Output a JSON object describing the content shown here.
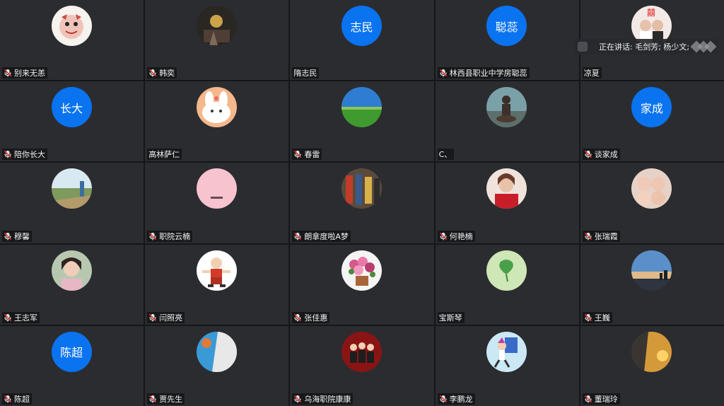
{
  "speaking_banner": {
    "text": "正在讲话: 毛剑芳; 杨少文;"
  },
  "participants": [
    {
      "name": "别来无恙",
      "avatar": "photo-cartoon-creature",
      "initials": "",
      "muted": true
    },
    {
      "name": "韩奕",
      "avatar": "photo-dark-scene",
      "initials": "",
      "muted": true
    },
    {
      "name": "隋志民",
      "avatar": "initials",
      "initials": "志民",
      "muted": false
    },
    {
      "name": "林西县职业中学房聪蕊",
      "avatar": "initials",
      "initials": "聪蕊",
      "muted": true
    },
    {
      "name": "凉夏",
      "avatar": "photo-couple",
      "initials": "",
      "muted": false
    },
    {
      "name": "陪你长大",
      "avatar": "initials",
      "initials": "长大",
      "muted": true
    },
    {
      "name": "高林萨仁",
      "avatar": "photo-cartoon-bunny",
      "initials": "",
      "muted": false
    },
    {
      "name": "春雷",
      "avatar": "photo-green-field",
      "initials": "",
      "muted": true
    },
    {
      "name": "C、",
      "avatar": "photo-rider",
      "initials": "",
      "muted": false
    },
    {
      "name": "谈家成",
      "avatar": "initials",
      "initials": "家成",
      "muted": true
    },
    {
      "name": "穆馨",
      "avatar": "photo-landscape",
      "initials": "",
      "muted": true
    },
    {
      "name": "职院云楠",
      "avatar": "photo-pink-card",
      "initials": "",
      "muted": true
    },
    {
      "name": "朗拿度啦A梦",
      "avatar": "photo-crowd",
      "initials": "",
      "muted": true
    },
    {
      "name": "何艳楠",
      "avatar": "photo-woman-red",
      "initials": "",
      "muted": true
    },
    {
      "name": "张瑞霞",
      "avatar": "photo-babies",
      "initials": "",
      "muted": true
    },
    {
      "name": "王志军",
      "avatar": "photo-girl-portrait",
      "initials": "",
      "muted": true
    },
    {
      "name": "闫照亮",
      "avatar": "photo-cartoon-kungfu",
      "initials": "",
      "muted": true
    },
    {
      "name": "张佳惠",
      "avatar": "photo-flowers",
      "initials": "",
      "muted": true
    },
    {
      "name": "宝斯琴",
      "avatar": "photo-ginkgo-leaf",
      "initials": "",
      "muted": false
    },
    {
      "name": "王巍",
      "avatar": "photo-sky-city",
      "initials": "",
      "muted": true
    },
    {
      "name": "陈超",
      "avatar": "initials",
      "initials": "陈超",
      "muted": true
    },
    {
      "name": "贾先生",
      "avatar": "photo-pool",
      "initials": "",
      "muted": true
    },
    {
      "name": "乌海职院康康",
      "avatar": "photo-red-cartoon",
      "initials": "",
      "muted": true
    },
    {
      "name": "李鹏龙",
      "avatar": "photo-cartoon-runner",
      "initials": "",
      "muted": true
    },
    {
      "name": "董瑞玲",
      "avatar": "photo-sunset-rock",
      "initials": "",
      "muted": true
    }
  ]
}
